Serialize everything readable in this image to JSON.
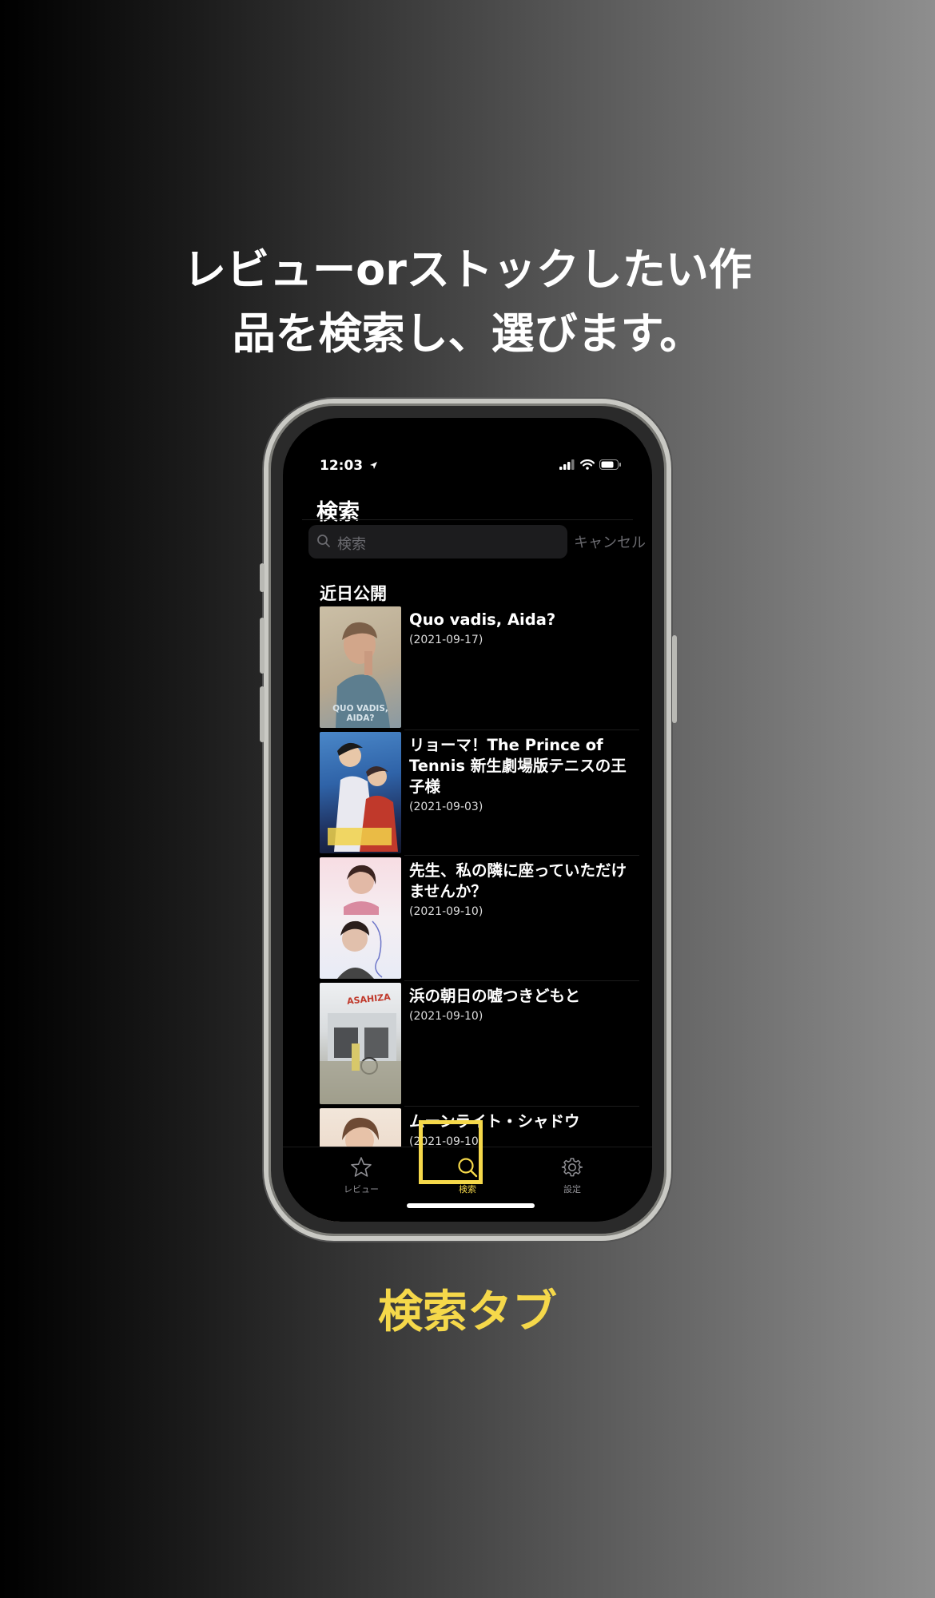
{
  "promo": {
    "headline_line1": "レビューorストックしたい作",
    "headline_line2": "品を検索し、選びます。",
    "caption": "検索タブ"
  },
  "status_bar": {
    "time": "12:03"
  },
  "screen": {
    "title": "検索",
    "search": {
      "placeholder": "検索",
      "cancel_label": "キャンセル"
    },
    "section_header": "近日公開",
    "movies": [
      {
        "title": "Quo vadis, Aida?",
        "date": "(2021-09-17)",
        "poster_text": "QUO VADIS, AIDA?"
      },
      {
        "title": "リョーマ！The Prince of Tennis 新生劇場版テニスの王子様",
        "date": "(2021-09-03)"
      },
      {
        "title": "先生、私の隣に座っていただけませんか？",
        "date": "(2021-09-10)"
      },
      {
        "title": "浜の朝日の嘘つきどもと",
        "date": "(2021-09-10)",
        "poster_text": "ASAHIZA"
      },
      {
        "title": "ムーンライト・シャドウ",
        "date": "(2021-09-10)"
      }
    ]
  },
  "tab_bar": {
    "tabs": [
      {
        "label": "レビュー",
        "icon": "star-icon",
        "selected": false
      },
      {
        "label": "検索",
        "icon": "search-icon",
        "selected": true
      },
      {
        "label": "設定",
        "icon": "gear-icon",
        "selected": false
      }
    ]
  },
  "colors": {
    "accent": "#f5d84a",
    "background": "#000000",
    "inactive": "#8e8e93"
  }
}
